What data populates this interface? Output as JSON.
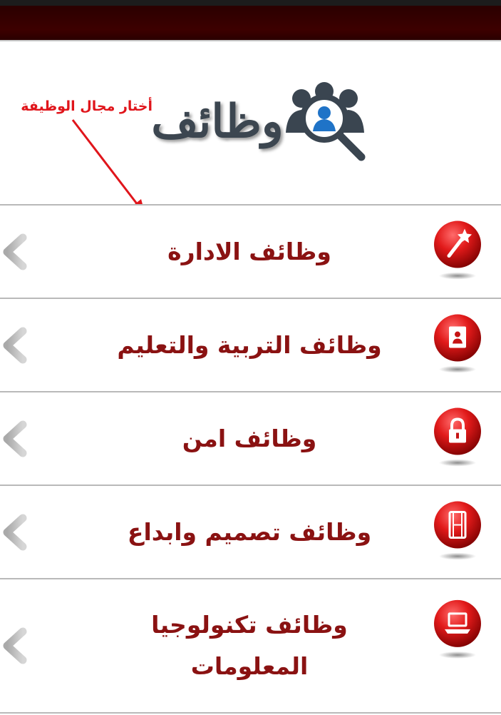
{
  "app": {
    "logo_text": "وظائف",
    "annotation": "أختار مجال الوظيفة"
  },
  "colors": {
    "appbar": "#3d0000",
    "label": "#8a1212",
    "icon_ball": "#e11a1a",
    "annotation": "#e0151b"
  },
  "categories": [
    {
      "label": "وظائف الادارة",
      "icon": "magic-wand-icon"
    },
    {
      "label": "وظائف التربية والتعليم",
      "icon": "address-book-icon"
    },
    {
      "label": "وظائف امن",
      "icon": "lock-icon"
    },
    {
      "label": "وظائف تصميم وابداع",
      "icon": "film-icon"
    },
    {
      "label": "وظائف تكنولوجيا المعلومات",
      "icon": "laptop-icon"
    }
  ]
}
